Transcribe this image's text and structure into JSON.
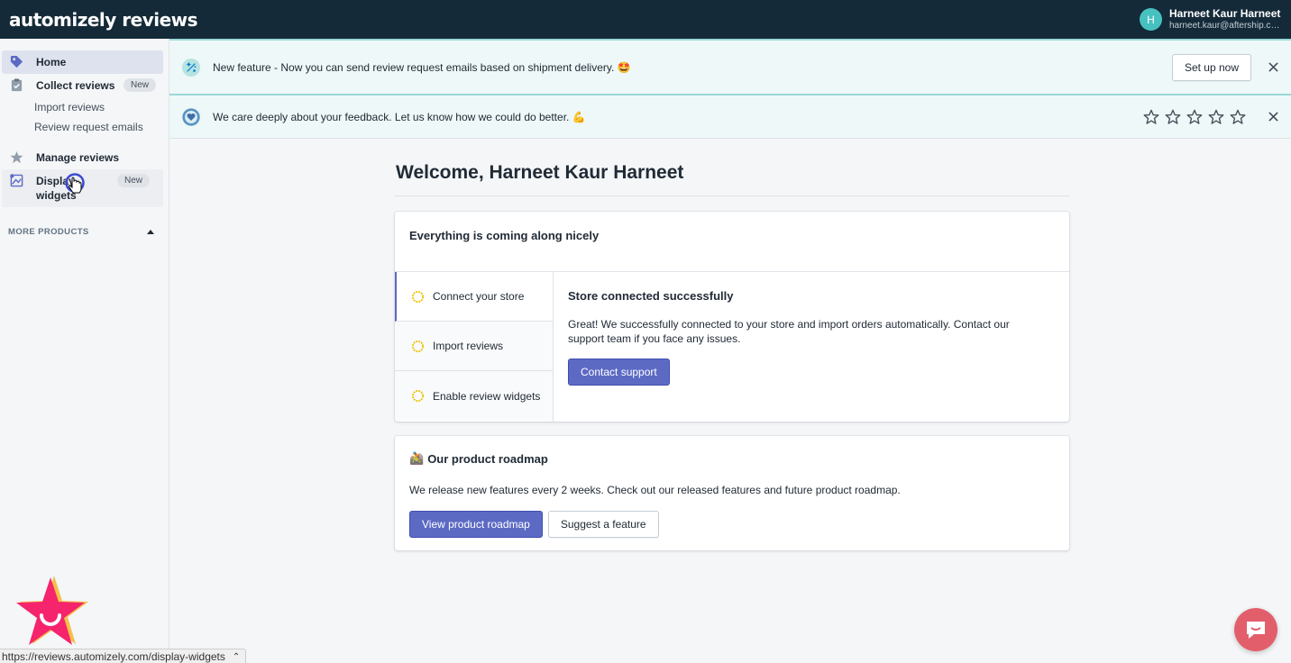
{
  "app": {
    "logo": "automizely reviews",
    "user": {
      "initial": "H",
      "name": "Harneet Kaur Harneet",
      "email": "harneet.kaur@aftership.com"
    }
  },
  "sidebar": {
    "items": [
      {
        "label": "Home",
        "icon": "tag-icon",
        "active": true
      },
      {
        "label": "Collect reviews",
        "icon": "clipboard-icon",
        "badge": "New"
      },
      {
        "label": "Import reviews"
      },
      {
        "label": "Review request emails"
      },
      {
        "label": "Manage reviews",
        "icon": "star-icon"
      },
      {
        "label": "Display widgets",
        "icon": "widget-icon",
        "badge": "New"
      }
    ],
    "more_products": "MORE PRODUCTS"
  },
  "banners": {
    "feature": {
      "text": "New feature - Now you can send review request emails based on shipment delivery. 🤩",
      "button": "Set up now"
    },
    "feedback": {
      "text": "We care deeply about your feedback. Let us know how we could do better. 💪",
      "stars": 5
    }
  },
  "main": {
    "welcome": "Welcome, Harneet Kaur Harneet",
    "setup": {
      "title": "Everything is coming along nicely",
      "steps": [
        "Connect your store",
        "Import reviews",
        "Enable review widgets"
      ],
      "active_title": "Store connected successfully",
      "active_desc": "Great! We successfully connected to your store and import orders automatically. Contact our support team if you face any issues.",
      "active_button": "Contact support"
    },
    "roadmap": {
      "emoji": "🚵",
      "title": "Our product roadmap",
      "desc": "We release new features every 2 weeks. Check out our released features and future product roadmap.",
      "primary_button": "View product roadmap",
      "secondary_button": "Suggest a feature"
    }
  },
  "status_url": "https://reviews.automizely.com/display-widgets",
  "colors": {
    "topbar": "#142a38",
    "accent": "#5c6ac4",
    "banner_bg": "#eef8f8",
    "mascot": "#f5246c",
    "chat": "#e35e6b"
  }
}
